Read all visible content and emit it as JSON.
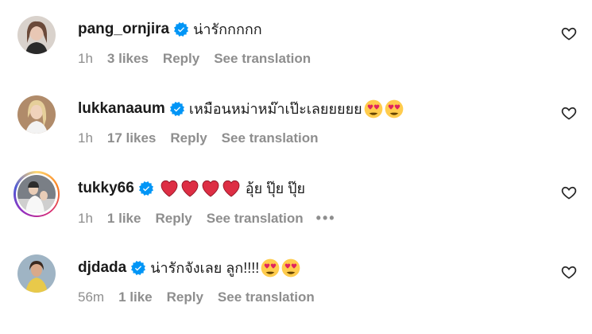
{
  "comments": [
    {
      "username": "pang_ornjira",
      "text": "น่ารักกกกก",
      "emojis": [],
      "time": "1h",
      "likes": "3 likes",
      "reply": "Reply",
      "translate": "See translation",
      "avatar_color": "#b89a8c"
    },
    {
      "username": "lukkanaaum",
      "text": "เหมือนหม่าหม๊าเป๊ะเลยยยยย",
      "emojis": [
        "heart-eyes-emoji",
        "heart-eyes-emoji"
      ],
      "time": "1h",
      "likes": "17 likes",
      "reply": "Reply",
      "translate": "See translation",
      "avatar_color": "#c9a27a"
    },
    {
      "username": "tukky66",
      "text_prefix_emojis": [
        "red-heart-emoji",
        "red-heart-emoji",
        "red-heart-emoji",
        "red-heart-emoji"
      ],
      "text": "อุ้ย ปุ๊ย ปุ๊ย",
      "time": "1h",
      "likes": "1 like",
      "reply": "Reply",
      "translate": "See translation",
      "more": "•••",
      "avatar_color": "#8a8f96",
      "has_story_ring": true
    },
    {
      "username": "djdada",
      "text": "น่ารักจังเลย ลูก!!!!",
      "emojis": [
        "heart-eyes-emoji",
        "heart-eyes-emoji"
      ],
      "time": "56m",
      "likes": "1 like",
      "reply": "Reply",
      "translate": "See translation",
      "avatar_color": "#d9c36a"
    }
  ],
  "colors": {
    "verified": "#0095f6",
    "muted": "#8e8e8e",
    "text": "#262626",
    "heart_red": "#ed1c24",
    "emoji_yellow": "#ffcc4d"
  }
}
